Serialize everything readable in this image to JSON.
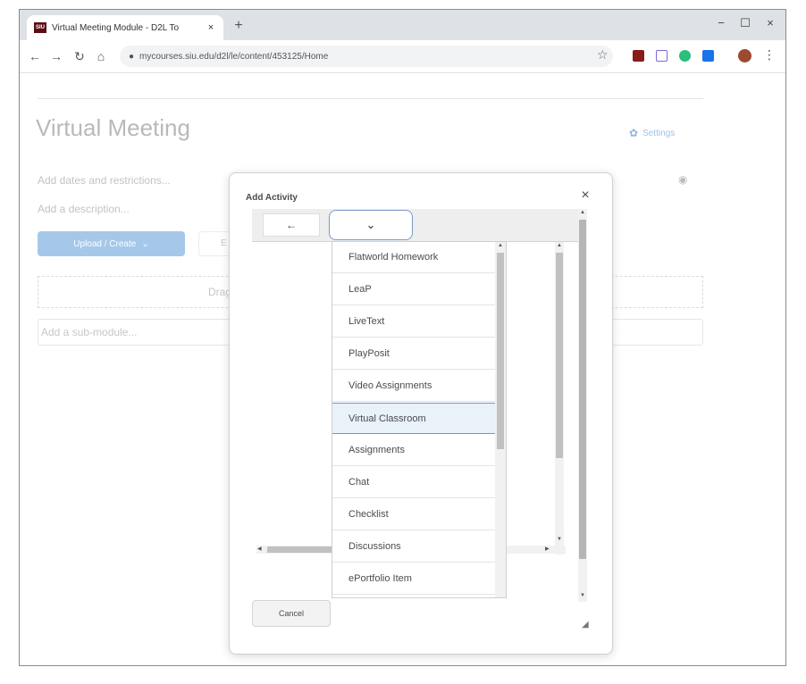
{
  "browser": {
    "tab_title": "Virtual Meeting Module - D2L To",
    "favicon_text": "SIU",
    "tab_close": "×",
    "new_tab": "+",
    "url": "mycourses.siu.edu/d2l/le/content/453125/Home",
    "minimize": "−",
    "maximize": "☐",
    "close": "×"
  },
  "page": {
    "title": "Virtual Meeting",
    "settings_label": "Settings",
    "dates_link": "Add dates and restrictions...",
    "description_link": "Add a description...",
    "upload_button": "Upload / Create",
    "ghost_button": "E",
    "drop_text": "Drag",
    "submodule_placeholder": "Add a sub-module..."
  },
  "dialog": {
    "title": "Add Activity",
    "close": "×",
    "back_icon": "←",
    "selector_icon": "⌄",
    "cancel_label": "Cancel",
    "selected_item": "Virtual Classroom",
    "items": [
      "Flatworld Homework",
      "LeaP",
      "LiveText",
      "PlayPosit",
      "Video Assignments",
      "Virtual Classroom",
      "Assignments",
      "Chat",
      "Checklist",
      "Discussions",
      "ePortfolio Item"
    ]
  },
  "colors": {
    "accent_button": "#a5c8ea",
    "selected_item_bg": "#e9f1f9",
    "selected_item_border": "#6f9cc7"
  }
}
